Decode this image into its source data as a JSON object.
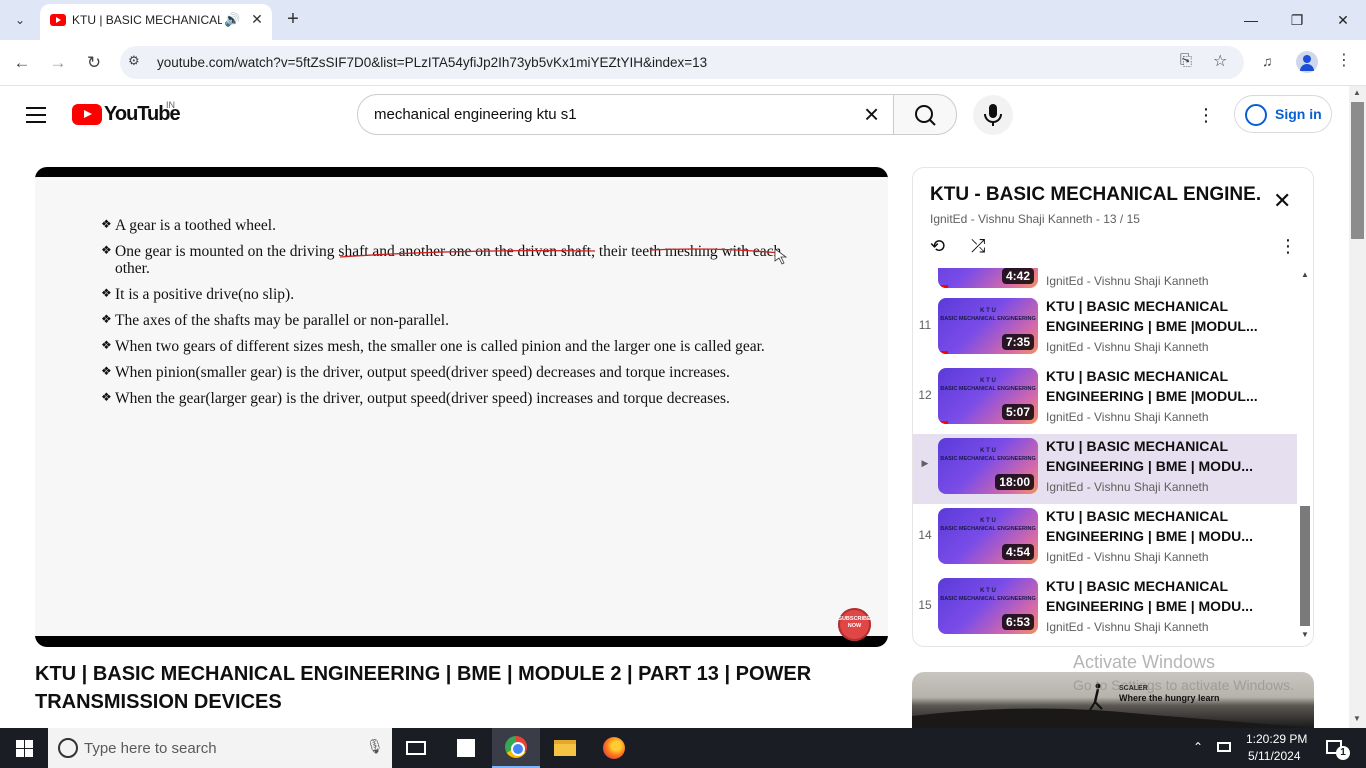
{
  "browser": {
    "tab_title": "KTU | BASIC MECHANICAL E",
    "url": "youtube.com/watch?v=5ftZsSIF7D0&list=PLzITA54yfiJp2Ih73yb5vKx1miYEZtYIH&index=13",
    "icons": [
      "tab-search-icon",
      "audio-icon",
      "close-icon",
      "new-tab-icon",
      "minimize-icon",
      "restore-icon",
      "close-window-icon",
      "back-icon",
      "forward-icon",
      "reload-icon",
      "site-info-icon",
      "install-icon",
      "star-icon",
      "media-icon",
      "profile-icon",
      "menu-icon"
    ]
  },
  "youtube": {
    "wordmark": "YouTube",
    "country": "IN",
    "search_value": "mechanical engineering ktu s1",
    "sign_in_label": "Sign in",
    "accent_color": "#065fd4",
    "brand_color": "#ff0000"
  },
  "video": {
    "slide_bullets": [
      "A gear is a toothed wheel.",
      "One gear is mounted on the driving shaft and another one on the driven shaft, their teeth meshing with each",
      "other.",
      "It is a positive drive(no slip).",
      "The axes of the shafts may be parallel or non-parallel.",
      "When two gears of different sizes mesh, the smaller one is called pinion and the larger one is called gear.",
      "When pinion(smaller gear) is the driver, output speed(driver speed) decreases and torque increases.",
      "When the gear(larger gear) is the driver, output speed(driver speed) increases and torque decreases."
    ],
    "subscribe_badge": "SUBSCRIBE NOW",
    "title_line1": "KTU | BASIC MECHANICAL ENGINEERING | BME | MODULE 2 | PART 13 | POWER",
    "title_line2": "TRANSMISSION DEVICES"
  },
  "playlist": {
    "title": "KTU - BASIC MECHANICAL ENGINE...",
    "meta": "IgnitEd - Vishnu Shaji Kanneth - 13 / 15",
    "partial_item": {
      "duration": "4:42",
      "channel": "IgnitEd - Vishnu Shaji Kanneth"
    },
    "items": [
      {
        "index": "11",
        "title": "KTU | BASIC MECHANICAL ENGINEERING | BME |MODUL...",
        "channel": "IgnitEd - Vishnu Shaji Kanneth",
        "duration": "7:35",
        "active": false
      },
      {
        "index": "12",
        "title": "KTU | BASIC MECHANICAL ENGINEERING | BME |MODUL...",
        "channel": "IgnitEd - Vishnu Shaji Kanneth",
        "duration": "5:07",
        "active": false
      },
      {
        "index": "▶",
        "title": "KTU | BASIC MECHANICAL ENGINEERING | BME | MODU...",
        "channel": "IgnitEd - Vishnu Shaji Kanneth",
        "duration": "18:00",
        "active": true
      },
      {
        "index": "14",
        "title": "KTU | BASIC MECHANICAL ENGINEERING | BME | MODU...",
        "channel": "IgnitEd - Vishnu Shaji Kanneth",
        "duration": "4:54",
        "active": false
      },
      {
        "index": "15",
        "title": "KTU | BASIC MECHANICAL ENGINEERING | BME | MODU...",
        "channel": "IgnitEd - Vishnu Shaji Kanneth",
        "duration": "6:53",
        "active": false
      }
    ],
    "active_bg": "#e6dff0"
  },
  "ad": {
    "brand": "SCALER",
    "tagline": "Where the hungry learn"
  },
  "watermark": {
    "title": "Activate Windows",
    "subtitle": "Go to Settings to activate Windows."
  },
  "taskbar": {
    "search_placeholder": "Type here to search",
    "time": "1:20:29 PM",
    "date": "5/11/2024",
    "notification_count": "1"
  }
}
